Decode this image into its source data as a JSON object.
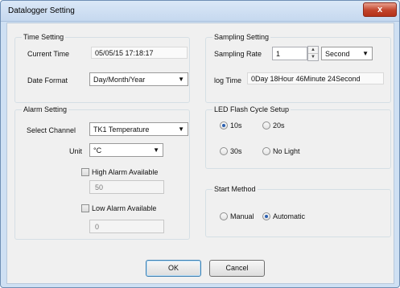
{
  "window": {
    "title": "Datalogger Setting",
    "close_glyph": "x"
  },
  "time_setting": {
    "title": "Time Setting",
    "current_time_label": "Current Time",
    "current_time_value": "05/05/15 17:18:17",
    "date_format_label": "Date Format",
    "date_format_value": "Day/Month/Year"
  },
  "sampling_setting": {
    "title": "Sampling Setting",
    "rate_label": "Sampling Rate",
    "rate_value": "1",
    "unit_value": "Second",
    "log_time_label": "log Time",
    "log_time_value": "0Day 18Hour 46Minute 24Second"
  },
  "alarm_setting": {
    "title": "Alarm Setting",
    "channel_label": "Select Channel",
    "channel_value": "TK1 Temperature",
    "unit_label": "Unit",
    "unit_value": "°C",
    "high_alarm_label": "High Alarm Available",
    "high_alarm_value": "50",
    "low_alarm_label": "Low Alarm Available",
    "low_alarm_value": "0"
  },
  "led_setup": {
    "title": "LED Flash Cycle Setup",
    "options": [
      "10s",
      "20s",
      "30s",
      "No Light"
    ],
    "selected": "10s"
  },
  "start_method": {
    "title": "Start Method",
    "options": [
      "Manual",
      "Automatic"
    ],
    "selected": "Automatic"
  },
  "buttons": {
    "ok": "OK",
    "cancel": "Cancel"
  },
  "icons": {
    "dropdown": "chevron-down-icon",
    "spin_up": "spin-up-icon",
    "spin_down": "spin-down-icon",
    "close": "close-icon"
  },
  "colors": {
    "title_bar": "#c5d8ef",
    "close_button": "#c2442b",
    "dialog_bg": "#f0f0f0",
    "radio_dot": "#2a5fb0"
  }
}
